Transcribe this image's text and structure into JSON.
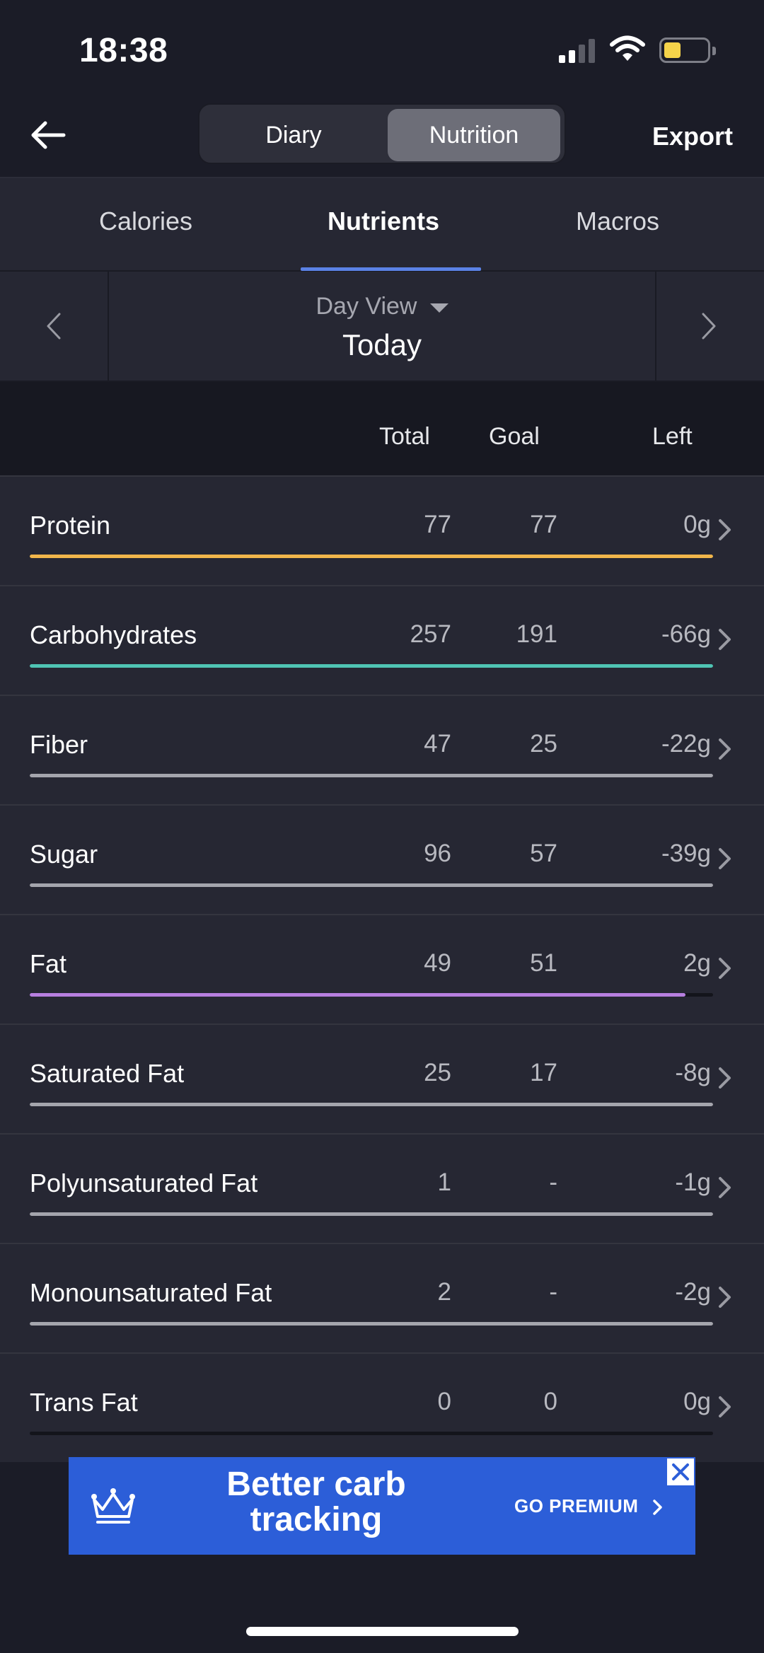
{
  "status_bar": {
    "time": "18:38"
  },
  "nav": {
    "segments": {
      "diary": "Diary",
      "nutrition": "Nutrition"
    },
    "export_label": "Export"
  },
  "tabs": {
    "calories": "Calories",
    "nutrients": "Nutrients",
    "macros": "Macros"
  },
  "date": {
    "view_label": "Day View",
    "current": "Today"
  },
  "columns": {
    "total": "Total",
    "goal": "Goal",
    "left": "Left"
  },
  "nutrients": [
    {
      "name": "Protein",
      "total": "77",
      "goal": "77",
      "left": "0g",
      "progress": 1.0,
      "color": "#f1b64b"
    },
    {
      "name": "Carbohydrates",
      "total": "257",
      "goal": "191",
      "left": "-66g",
      "progress": 1.0,
      "color": "#4fc4b4"
    },
    {
      "name": "Fiber",
      "total": "47",
      "goal": "25",
      "left": "-22g",
      "progress": 1.0,
      "color": "#a4a5ad"
    },
    {
      "name": "Sugar",
      "total": "96",
      "goal": "57",
      "left": "-39g",
      "progress": 1.0,
      "color": "#a4a5ad"
    },
    {
      "name": "Fat",
      "total": "49",
      "goal": "51",
      "left": "2g",
      "progress": 0.96,
      "color": "#b77fe0"
    },
    {
      "name": "Saturated Fat",
      "total": "25",
      "goal": "17",
      "left": "-8g",
      "progress": 1.0,
      "color": "#a4a5ad"
    },
    {
      "name": "Polyunsaturated Fat",
      "total": "1",
      "goal": "-",
      "left": "-1g",
      "progress": 1.0,
      "color": "#a4a5ad"
    },
    {
      "name": "Monounsaturated Fat",
      "total": "2",
      "goal": "-",
      "left": "-2g",
      "progress": 1.0,
      "color": "#a4a5ad"
    },
    {
      "name": "Trans Fat",
      "total": "0",
      "goal": "0",
      "left": "0g",
      "progress": 0.0,
      "color": "#a4a5ad"
    }
  ],
  "ad": {
    "headline": "Better carb tracking",
    "cta": "GO PREMIUM"
  }
}
